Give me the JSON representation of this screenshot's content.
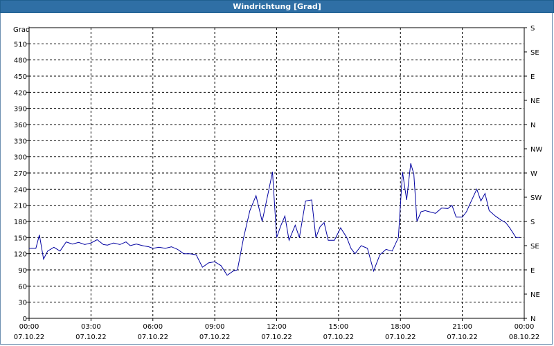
{
  "window": {
    "title": "Windrichtung [Grad]"
  },
  "colors": {
    "title_bar": "#2f6fa5",
    "line": "#0000a0",
    "grid": "#000000"
  },
  "chart_data": {
    "type": "line",
    "title": "Windrichtung [Grad]",
    "ylabel": "Grad",
    "ylim": [
      0,
      540
    ],
    "grid": true,
    "grid_style": "dashed",
    "y_ticks": [
      0,
      30,
      60,
      90,
      120,
      150,
      180,
      210,
      240,
      270,
      300,
      330,
      360,
      390,
      420,
      450,
      480,
      510
    ],
    "y_right_labels": [
      "N",
      "NE",
      "E",
      "SE",
      "S",
      "SW",
      "W",
      "NW",
      "N",
      "NE",
      "E",
      "SE",
      "S"
    ],
    "x_range_hours": [
      0,
      24
    ],
    "x_ticks": [
      {
        "time": "00:00",
        "date": "07.10.22"
      },
      {
        "time": "03:00",
        "date": "07.10.22"
      },
      {
        "time": "06:00",
        "date": "07.10.22"
      },
      {
        "time": "09:00",
        "date": "07.10.22"
      },
      {
        "time": "12:00",
        "date": "07.10.22"
      },
      {
        "time": "15:00",
        "date": "07.10.22"
      },
      {
        "time": "18:00",
        "date": "07.10.22"
      },
      {
        "time": "21:00",
        "date": "07.10.22"
      },
      {
        "time": "00:00",
        "date": "08.10.22"
      }
    ],
    "series": [
      {
        "x": [
          0.0,
          0.33,
          0.5,
          0.7,
          0.9,
          1.2,
          1.5,
          1.8,
          2.1,
          2.4,
          2.7,
          3.0,
          3.3,
          3.6,
          3.8,
          4.1,
          4.4,
          4.7,
          4.9,
          5.2,
          5.5,
          5.8,
          6.0,
          6.3,
          6.6,
          6.9,
          7.2,
          7.5,
          7.8,
          8.1,
          8.4,
          8.7,
          9.0,
          9.3,
          9.6,
          9.9,
          10.1,
          10.4,
          10.7,
          11.0,
          11.3,
          11.6,
          11.8,
          12.0,
          12.2,
          12.4,
          12.6,
          12.9,
          13.1,
          13.4,
          13.7,
          13.9,
          14.1,
          14.3,
          14.5,
          14.8,
          15.1,
          15.4,
          15.6,
          15.8,
          16.1,
          16.4,
          16.7,
          17.0,
          17.3,
          17.6,
          17.9,
          18.1,
          18.3,
          18.5,
          18.65,
          18.8,
          19.0,
          19.2,
          19.4,
          19.7,
          20.0,
          20.3,
          20.5,
          20.7,
          21.0,
          21.2,
          21.4,
          21.7,
          21.9,
          22.1,
          22.3,
          22.6,
          22.9,
          23.1,
          23.3,
          23.6,
          23.8
        ],
        "y": [
          130,
          130,
          155,
          110,
          125,
          132,
          125,
          142,
          138,
          141,
          137,
          140,
          146,
          137,
          136,
          140,
          137,
          142,
          135,
          138,
          135,
          133,
          130,
          132,
          130,
          133,
          128,
          120,
          120,
          118,
          95,
          103,
          105,
          98,
          80,
          88,
          90,
          150,
          200,
          228,
          180,
          235,
          272,
          150,
          172,
          190,
          145,
          173,
          150,
          218,
          220,
          150,
          170,
          178,
          145,
          145,
          168,
          150,
          130,
          120,
          135,
          130,
          88,
          118,
          128,
          125,
          150,
          272,
          220,
          288,
          268,
          180,
          198,
          200,
          198,
          195,
          205,
          204,
          210,
          188,
          188,
          198,
          215,
          240,
          218,
          232,
          200,
          190,
          182,
          178,
          168,
          150,
          150
        ]
      }
    ]
  }
}
